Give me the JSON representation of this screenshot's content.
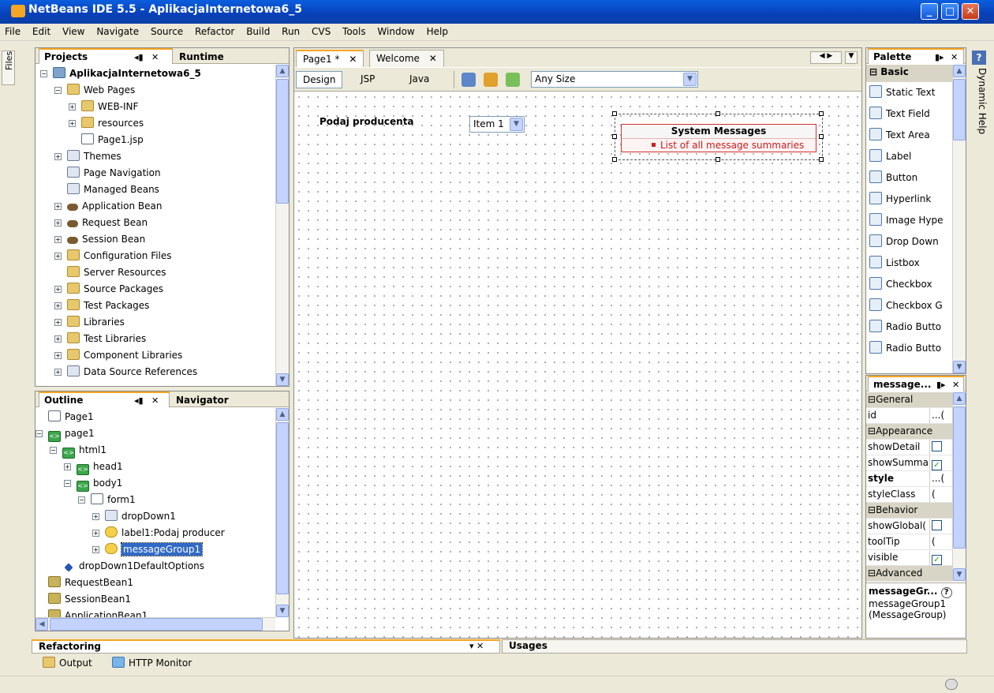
{
  "window": {
    "title": "NetBeans IDE 5.5 - AplikacjaInternetowa6_5"
  },
  "menu": [
    "File",
    "Edit",
    "View",
    "Navigate",
    "Source",
    "Refactor",
    "Build",
    "Run",
    "CVS",
    "Tools",
    "Window",
    "Help"
  ],
  "side_tabs": {
    "left": "Files",
    "right": "Dynamic Help"
  },
  "projects_panel": {
    "tabs": [
      "Projects",
      "Runtime"
    ],
    "tree": [
      {
        "label": "AplikacjaInternetowa6_5",
        "level": 0,
        "icon": "project-icon",
        "exp": "-",
        "bold": true
      },
      {
        "label": "Web Pages",
        "level": 1,
        "icon": "folder-icon",
        "exp": "-"
      },
      {
        "label": "WEB-INF",
        "level": 2,
        "icon": "folder-icon",
        "exp": "+"
      },
      {
        "label": "resources",
        "level": 2,
        "icon": "folder-icon",
        "exp": "+"
      },
      {
        "label": "Page1.jsp",
        "level": 2,
        "icon": "jsp-page-icon",
        "exp": ""
      },
      {
        "label": "Themes",
        "level": 1,
        "icon": "themes-icon",
        "exp": "+"
      },
      {
        "label": "Page Navigation",
        "level": 1,
        "icon": "page-navigation-icon",
        "exp": ""
      },
      {
        "label": "Managed Beans",
        "level": 1,
        "icon": "managed-beans-icon",
        "exp": ""
      },
      {
        "label": "Application Bean",
        "level": 1,
        "icon": "bean-icon",
        "exp": "+"
      },
      {
        "label": "Request Bean",
        "level": 1,
        "icon": "bean-icon",
        "exp": "+"
      },
      {
        "label": "Session Bean",
        "level": 1,
        "icon": "bean-icon",
        "exp": "+"
      },
      {
        "label": "Configuration Files",
        "level": 1,
        "icon": "config-folder-icon",
        "exp": "+"
      },
      {
        "label": "Server Resources",
        "level": 1,
        "icon": "server-folder-icon",
        "exp": ""
      },
      {
        "label": "Source Packages",
        "level": 1,
        "icon": "package-folder-icon",
        "exp": "+"
      },
      {
        "label": "Test Packages",
        "level": 1,
        "icon": "package-folder-icon",
        "exp": "+"
      },
      {
        "label": "Libraries",
        "level": 1,
        "icon": "library-folder-icon",
        "exp": "+"
      },
      {
        "label": "Test Libraries",
        "level": 1,
        "icon": "library-folder-icon",
        "exp": "+"
      },
      {
        "label": "Component Libraries",
        "level": 1,
        "icon": "library-folder-icon",
        "exp": "+"
      },
      {
        "label": "Data Source References",
        "level": 1,
        "icon": "datasource-icon",
        "exp": "+"
      }
    ]
  },
  "outline_panel": {
    "tabs": [
      "Outline",
      "Navigator"
    ],
    "tree": [
      {
        "label": "Page1",
        "level": 0,
        "icon": "page-icon",
        "exp": ""
      },
      {
        "label": "page1",
        "level": 0,
        "icon": "tag-icon",
        "exp": "-"
      },
      {
        "label": "html1",
        "level": 1,
        "icon": "tag-icon",
        "exp": "-"
      },
      {
        "label": "head1",
        "level": 2,
        "icon": "tag-icon",
        "exp": "+"
      },
      {
        "label": "body1",
        "level": 2,
        "icon": "tag-icon",
        "exp": "-"
      },
      {
        "label": "form1",
        "level": 3,
        "icon": "form-icon",
        "exp": "-"
      },
      {
        "label": "dropDown1",
        "level": 4,
        "icon": "dropdown-icon",
        "exp": "+"
      },
      {
        "label": "label1:Podaj producer",
        "level": 4,
        "icon": "label-icon",
        "exp": "+"
      },
      {
        "label": "messageGroup1",
        "level": 4,
        "icon": "message-group-icon",
        "exp": "+",
        "selected": true
      },
      {
        "label": "dropDown1DefaultOptions",
        "level": 1,
        "icon": "options-icon",
        "exp": ""
      },
      {
        "label": "RequestBean1",
        "level": 0,
        "icon": "bean-class-icon",
        "exp": ""
      },
      {
        "label": "SessionBean1",
        "level": 0,
        "icon": "bean-class-icon",
        "exp": ""
      },
      {
        "label": "ApplicationBean1",
        "level": 0,
        "icon": "bean-class-icon",
        "exp": ""
      }
    ]
  },
  "editor": {
    "tabs": [
      "Page1 *",
      "Welcome"
    ],
    "views": [
      "Design",
      "JSP",
      "Java"
    ],
    "size_combo": "Any Size",
    "canvas": {
      "label": "Podaj producenta",
      "dropdown_value": "Item 1",
      "message_group": {
        "title": "System Messages",
        "item": "List of all message summaries"
      }
    }
  },
  "palette": {
    "title": "Palette",
    "category": "Basic",
    "items": [
      "Static Text",
      "Text Field",
      "Text Area",
      "Label",
      "Button",
      "Hyperlink",
      "Image Hype",
      "Drop Down",
      "Listbox",
      "Checkbox",
      "Checkbox G",
      "Radio Butto",
      "Radio Butto"
    ]
  },
  "properties": {
    "title": "message...",
    "rows": [
      {
        "name": "General",
        "cat": true
      },
      {
        "name": "id",
        "value": "...(",
        "bold": false
      },
      {
        "name": "Appearance",
        "cat": true
      },
      {
        "name": "showDetail",
        "check": false
      },
      {
        "name": "showSumma",
        "check": true
      },
      {
        "name": "style",
        "value": "...(",
        "bold": true
      },
      {
        "name": "styleClass",
        "value": "("
      },
      {
        "name": "Behavior",
        "cat": true
      },
      {
        "name": "showGlobal(",
        "check": false
      },
      {
        "name": "toolTip",
        "value": "("
      },
      {
        "name": "visible",
        "check": true
      },
      {
        "name": "Advanced",
        "cat": true
      }
    ],
    "desc_title": "messageGr...",
    "desc_line1": "messageGroup1",
    "desc_line2": "(MessageGroup)"
  },
  "bottom": {
    "tabs": [
      "Refactoring",
      "Usages"
    ],
    "buttons": [
      "Output",
      "HTTP Monitor"
    ]
  }
}
